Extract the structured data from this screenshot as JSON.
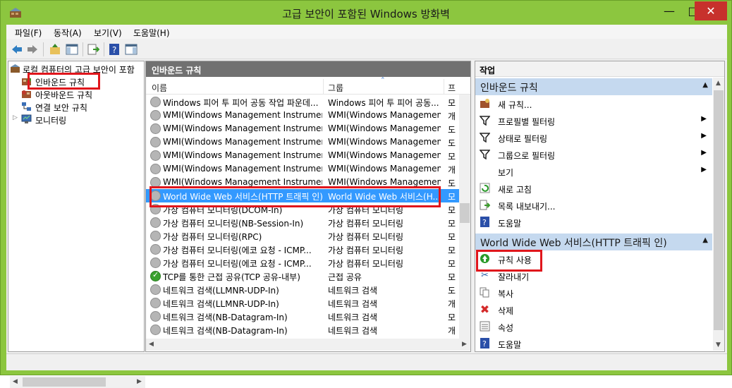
{
  "window": {
    "title": "고급 보안이 포함된 Windows 방화벽",
    "minimize": "—",
    "maximize": "□",
    "close": "✕"
  },
  "menubar": [
    "파일(F)",
    "동작(A)",
    "보기(V)",
    "도움말(H)"
  ],
  "tree": {
    "root": "로컬 컴퓨터의 고급 보안이 포함",
    "items": [
      "인바운드 규칙",
      "아웃바운드 규칙",
      "연결 보안 규칙",
      "모니터링"
    ]
  },
  "middle": {
    "header": "인바운드 규칙",
    "columns": [
      "이름",
      "그룹",
      "프"
    ],
    "rows": [
      {
        "name": "Windows 피어 투 피어 공동 작업 파운데...",
        "group": "Windows 피어 투 피어 공동...",
        "profile": "모",
        "enabled": false
      },
      {
        "name": "WMI(Windows Management Instrument...",
        "group": "WMI(Windows Managemen...",
        "profile": "개",
        "enabled": false
      },
      {
        "name": "WMI(Windows Management Instrument...",
        "group": "WMI(Windows Managemen...",
        "profile": "도",
        "enabled": false
      },
      {
        "name": "WMI(Windows Management Instrument...",
        "group": "WMI(Windows Managemen...",
        "profile": "도",
        "enabled": false
      },
      {
        "name": "WMI(Windows Management Instrument...",
        "group": "WMI(Windows Managemen...",
        "profile": "모",
        "enabled": false
      },
      {
        "name": "WMI(Windows Management Instrument...",
        "group": "WMI(Windows Managemen...",
        "profile": "개",
        "enabled": false
      },
      {
        "name": "WMI(Windows Management Instrument...",
        "group": "WMI(Windows Managemen...",
        "profile": "도",
        "enabled": false
      },
      {
        "name": "World Wide Web 서비스(HTTP 트래픽 인)",
        "group": "World Wide Web 서비스(H...",
        "profile": "모",
        "enabled": false,
        "selected": true
      },
      {
        "name": "가상 컴퓨터 모니터링(DCOM-In)",
        "group": "가상 컴퓨터 모니터링",
        "profile": "모",
        "enabled": false
      },
      {
        "name": "가상 컴퓨터 모니터링(NB-Session-In)",
        "group": "가상 컴퓨터 모니터링",
        "profile": "모",
        "enabled": false
      },
      {
        "name": "가상 컴퓨터 모니터링(RPC)",
        "group": "가상 컴퓨터 모니터링",
        "profile": "모",
        "enabled": false
      },
      {
        "name": "가상 컴퓨터 모니터링(에코 요청 - ICMP...",
        "group": "가상 컴퓨터 모니터링",
        "profile": "모",
        "enabled": false
      },
      {
        "name": "가상 컴퓨터 모니터링(에코 요청 - ICMP...",
        "group": "가상 컴퓨터 모니터링",
        "profile": "모",
        "enabled": false
      },
      {
        "name": "TCP를 통한 근접 공유(TCP 공유-내부)",
        "group": "근접 공유",
        "profile": "모",
        "enabled": true
      },
      {
        "name": "네트워크 검색(LLMNR-UDP-In)",
        "group": "네트워크 검색",
        "profile": "도",
        "enabled": false
      },
      {
        "name": "네트워크 검색(LLMNR-UDP-In)",
        "group": "네트워크 검색",
        "profile": "개",
        "enabled": false
      },
      {
        "name": "네트워크 검색(NB-Datagram-In)",
        "group": "네트워크 검색",
        "profile": "모",
        "enabled": false
      },
      {
        "name": "네트워크 검색(NB-Datagram-In)",
        "group": "네트워크 검색",
        "profile": "개",
        "enabled": false
      }
    ]
  },
  "actions": {
    "header": "작업",
    "section1": "인바운드 규칙",
    "items1": [
      "새 규칙...",
      "프로필별 필터링",
      "상태로 필터링",
      "그룹으로 필터링",
      "보기",
      "새로 고침",
      "목록 내보내기...",
      "도움말"
    ],
    "section2": "World Wide Web 서비스(HTTP 트래픽 인)",
    "items2": [
      "규칙 사용",
      "잘라내기",
      "복사",
      "삭제",
      "속성",
      "도움말"
    ]
  }
}
